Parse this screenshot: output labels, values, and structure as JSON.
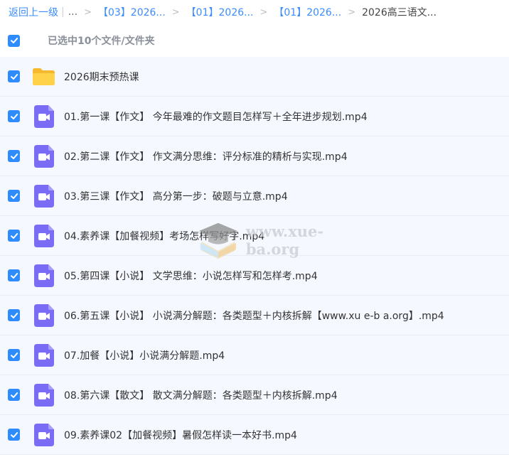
{
  "breadcrumb": {
    "back": "返回上一级",
    "separator": "|",
    "ellipsis": "...",
    "chevron": ">",
    "crumbs": [
      "【03】2026...",
      "【01】2026...",
      "【01】2026..."
    ],
    "current": "2026高三语文..."
  },
  "selection": {
    "label": "已选中10个文件/文件夹",
    "checked": true
  },
  "files": [
    {
      "name": "2026期末预热课",
      "type": "folder",
      "icon": "folder-icon"
    },
    {
      "name": "01.第一课【作文】 今年最难的作文题目怎样写＋全年进步规划.mp4",
      "type": "video",
      "icon": "video-file-icon"
    },
    {
      "name": "02.第二课【作文】 作文满分思维：评分标准的精析与实现.mp4",
      "type": "video",
      "icon": "video-file-icon"
    },
    {
      "name": "03.第三课【作文】 高分第一步：破题与立意.mp4",
      "type": "video",
      "icon": "video-file-icon"
    },
    {
      "name": "04.素养课【加餐视频】考场怎样写好字.mp4",
      "type": "video",
      "icon": "video-file-icon"
    },
    {
      "name": "05.第四课【小说】 文学思维：小说怎样写和怎样考.mp4",
      "type": "video",
      "icon": "video-file-icon"
    },
    {
      "name": "06.第五课【小说】 小说满分解题：各类题型＋内核拆解【www.xu e-b a.org】.mp4",
      "type": "video",
      "icon": "video-file-icon"
    },
    {
      "name": "07.加餐【小说】小说满分解题.mp4",
      "type": "video",
      "icon": "video-file-icon"
    },
    {
      "name": "08.第六课【散文】 散文满分解题：各类题型＋内核拆解.mp4",
      "type": "video",
      "icon": "video-file-icon"
    },
    {
      "name": "09.素养课02【加餐视频】暑假怎样读一本好书.mp4",
      "type": "video",
      "icon": "video-file-icon"
    }
  ],
  "watermark": {
    "text": "www.xue-ba.org"
  },
  "colors": {
    "accent": "#2f8cff",
    "link": "#3b8cff",
    "folder": "#ffcd3c",
    "video": "#7b6cf6",
    "row_bg": "#f5f9ff"
  }
}
